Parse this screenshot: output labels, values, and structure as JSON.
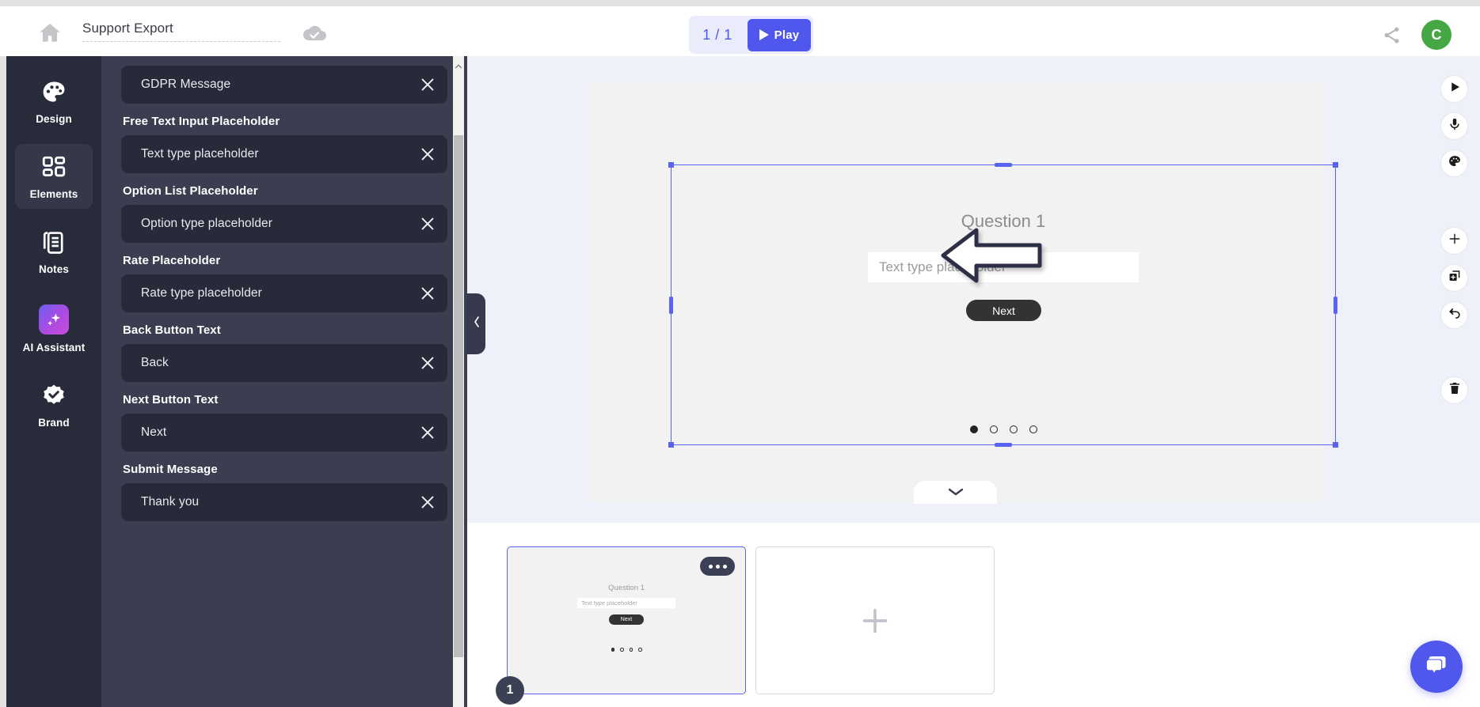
{
  "topbar": {
    "home_icon": "home-icon",
    "project_title": "Support Export",
    "saved_icon": "cloud-check-icon",
    "page_indicator": "1 / 1",
    "play_label": "Play",
    "share_icon": "share-icon",
    "avatar_initial": "C"
  },
  "rail": {
    "items": [
      {
        "label": "Design",
        "icon": "palette-icon",
        "active": false
      },
      {
        "label": "Elements",
        "icon": "grid-icon",
        "active": true
      },
      {
        "label": "Notes",
        "icon": "notes-icon",
        "active": false
      },
      {
        "label": "AI Assistant",
        "icon": "sparkle-icon",
        "active": false
      },
      {
        "label": "Brand",
        "icon": "badge-check-icon",
        "active": false
      }
    ]
  },
  "panel": {
    "fields": [
      {
        "label": "",
        "value": "GDPR Message"
      },
      {
        "label": "Free Text Input Placeholder",
        "value": "Text type placeholder"
      },
      {
        "label": "Option List Placeholder",
        "value": "Option type placeholder"
      },
      {
        "label": "Rate Placeholder",
        "value": "Rate type placeholder"
      },
      {
        "label": "Back Button Text",
        "value": "Back"
      },
      {
        "label": "Next Button Text",
        "value": "Next"
      },
      {
        "label": "Submit Message",
        "value": "Thank you"
      }
    ],
    "clear_icon": "close-icon"
  },
  "canvas": {
    "question_title": "Question 1",
    "input_placeholder": "Text type placeholder",
    "next_label": "Next",
    "dots_total": 4,
    "dots_active_index": 0,
    "collapse_icon": "chevron-left-icon",
    "bottom_collapse_icon": "chevron-down-icon",
    "annotation": "left-arrow-annotation",
    "tools": [
      {
        "icon": "play-icon",
        "name": "preview-button"
      },
      {
        "icon": "microphone-icon",
        "name": "record-voice-button"
      },
      {
        "icon": "palette-icon",
        "name": "theme-button"
      },
      {
        "icon": "plus-icon",
        "name": "add-element-button"
      },
      {
        "icon": "duplicate-icon",
        "name": "duplicate-button"
      },
      {
        "icon": "undo-icon",
        "name": "undo-button"
      },
      {
        "icon": "trash-icon",
        "name": "delete-button"
      }
    ]
  },
  "tray": {
    "slide_number": "1",
    "more_icon": "more-options-icon",
    "add_slide_icon": "plus-icon",
    "thumb": {
      "question_title": "Question 1",
      "input_placeholder": "Text type placeholder",
      "next_label": "Next"
    }
  },
  "chat": {
    "icon": "chat-bubble-icon"
  },
  "colors": {
    "accent": "#4f57ec",
    "panel_bg": "#3b3e51",
    "rail_bg": "#282b3a",
    "field_bg": "#272a38",
    "avatar_green": "#45a845",
    "selection_blue": "#5a62f0"
  }
}
